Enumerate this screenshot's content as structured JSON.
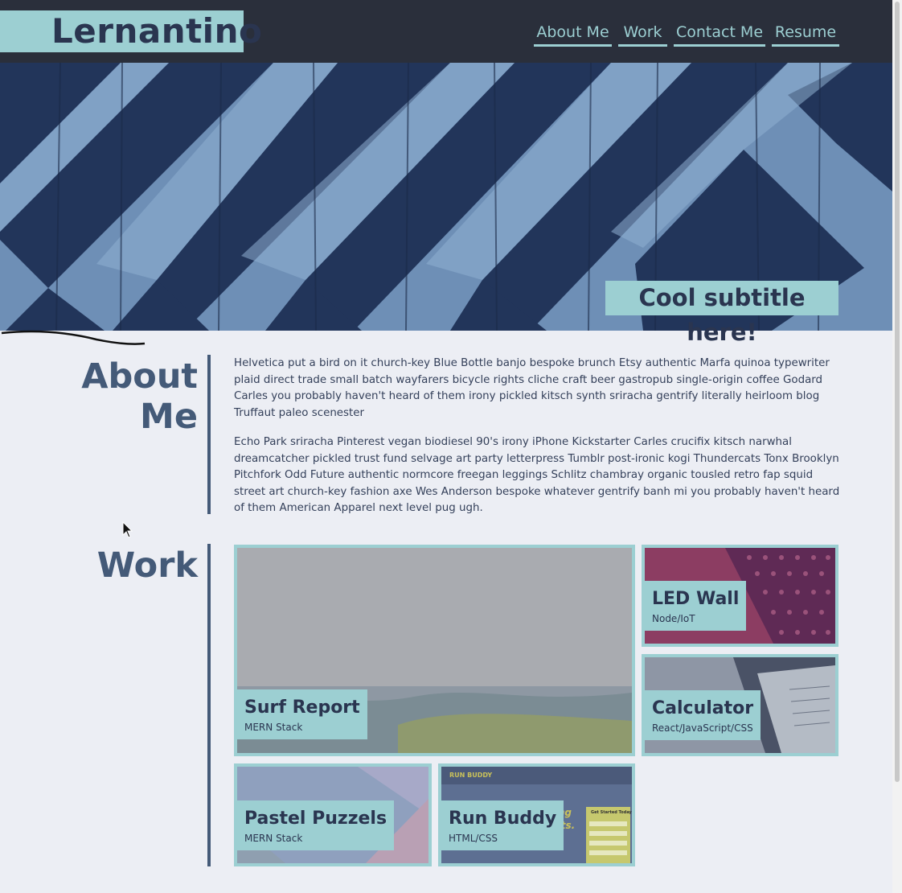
{
  "header": {
    "logo": "Lernantino",
    "nav": [
      "About Me",
      "Work",
      "Contact Me",
      "Resume"
    ]
  },
  "hero": {
    "subtitle": "Cool subtitle here!"
  },
  "about": {
    "title_line1": "About",
    "title_line2": "Me",
    "paragraphs": [
      "Helvetica put a bird on it church-key Blue Bottle banjo bespoke brunch Etsy authentic Marfa quinoa typewriter plaid direct trade small batch wayfarers bicycle rights cliche craft beer gastropub single-origin coffee Godard Carles you probably haven't heard of them irony pickled kitsch synth sriracha gentrify literally heirloom blog Truffaut paleo scenester",
      "Echo Park sriracha Pinterest vegan biodiesel 90's irony iPhone Kickstarter Carles crucifix kitsch narwhal dreamcatcher pickled trust fund selvage art party letterpress Tumblr post-ironic kogi Thundercats Tonx Brooklyn Pitchfork Odd Future authentic normcore freegan leggings Schlitz chambray organic tousled retro fap squid street art church-key fashion axe Wes Anderson bespoke whatever gentrify banh mi you probably haven't heard of them American Apparel next level pug ugh."
    ]
  },
  "work": {
    "title": "Work",
    "projects": [
      {
        "title": "Surf Report",
        "tech": "MERN Stack"
      },
      {
        "title": "LED Wall",
        "tech": "Node/IoT"
      },
      {
        "title": "Calculator",
        "tech": "React/JavaScript/CSS"
      },
      {
        "title": "Pastel Puzzels",
        "tech": "MERN Stack"
      },
      {
        "title": "Run Buddy",
        "tech": "HTML/CSS"
      }
    ],
    "run_buddy_image_text": {
      "brand": "RUN BUDDY",
      "tagline_1": "lding",
      "tagline_2": "abits.",
      "form_title": "Get Started Today"
    }
  },
  "colors": {
    "header_bg": "#2a2f3b",
    "accent": "#9ccfd2",
    "heading": "#445a78",
    "page_bg": "#eceef4"
  }
}
